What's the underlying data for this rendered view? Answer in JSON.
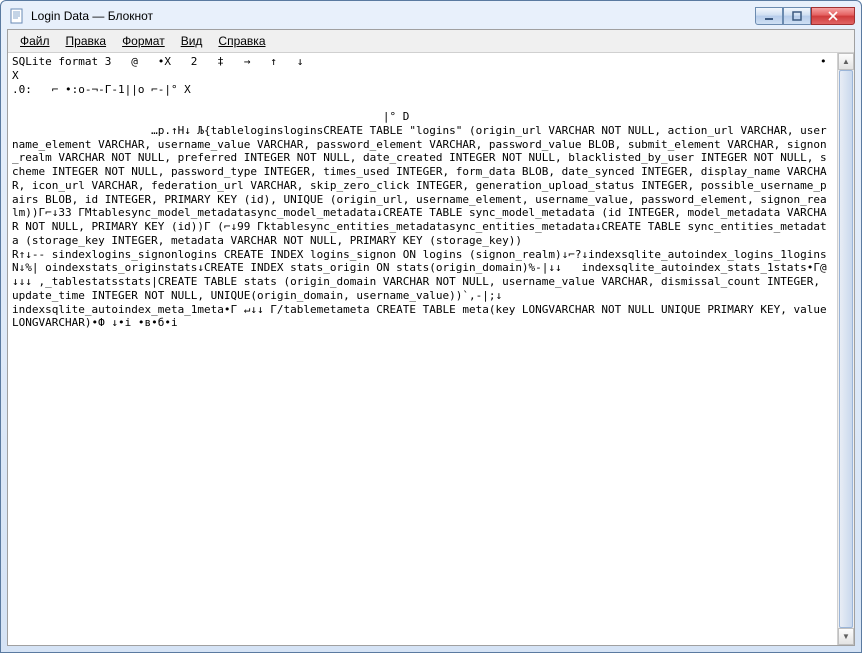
{
  "window": {
    "title": "Login Data — Блокнот"
  },
  "menubar": {
    "file": "Файл",
    "edit": "Правка",
    "format": "Формат",
    "view": "Вид",
    "help": "Справка"
  },
  "content": "SQLite format 3   @   •X   2   ‡   →   ↑   ↓                                                                              •X\n.0:   ⌐ •:o-¬-Г-1||o ⌐-|° X\n\n                                                        |° D\n                     …p.↑H↓ Љ{tableloginsloginsCREATE TABLE \"logins\" (origin_url VARCHAR NOT NULL, action_url VARCHAR, username_element VARCHAR, username_value VARCHAR, password_element VARCHAR, password_value BLOB, submit_element VARCHAR, signon_realm VARCHAR NOT NULL, preferred INTEGER NOT NULL, date_created INTEGER NOT NULL, blacklisted_by_user INTEGER NOT NULL, scheme INTEGER NOT NULL, password_type INTEGER, times_used INTEGER, form_data BLOB, date_synced INTEGER, display_name VARCHAR, icon_url VARCHAR, federation_url VARCHAR, skip_zero_click INTEGER, generation_upload_status INTEGER, possible_username_pairs BLOB, id INTEGER, PRIMARY KEY (id), UNIQUE (origin_url, username_element, username_value, password_element, signon_realm))Г⌐↓33 ГMtablesync_model_metadatasync_model_metadata↓CREATE TABLE sync_model_metadata (id INTEGER, model_metadata VARCHAR NOT NULL, PRIMARY KEY (id))Г (⌐↓99 Гktablesync_entities_metadatasync_entities_metadata↓CREATE TABLE sync_entities_metadata (storage_key INTEGER, metadata VARCHAR NOT NULL, PRIMARY KEY (storage_key))\nR↑↓-- sindexlogins_signonlogins CREATE INDEX logins_signon ON logins (signon_realm)↓⌐?↓indexsqlite_autoindex_logins_1loginsN↓%| oindexstats_originstats↓CREATE INDEX stats_origin ON stats(origin_domain)%-|↓↓   indexsqlite_autoindex_stats_1stats•Г@↓↓↓ ,_tablestatsstats|CREATE TABLE stats (origin_domain VARCHAR NOT NULL, username_value VARCHAR, dismissal_count INTEGER, update_time INTEGER NOT NULL, UNIQUE(origin_domain, username_value))`,-|;↓\nindexsqlite_autoindex_meta_1meta•Г ↵↓↓ Г/tablemetameta CREATE TABLE meta(key LONGVARCHAR NOT NULL UNIQUE PRIMARY KEY, value LONGVARCHAR)•Ф ↓•i •в•б•i"
}
